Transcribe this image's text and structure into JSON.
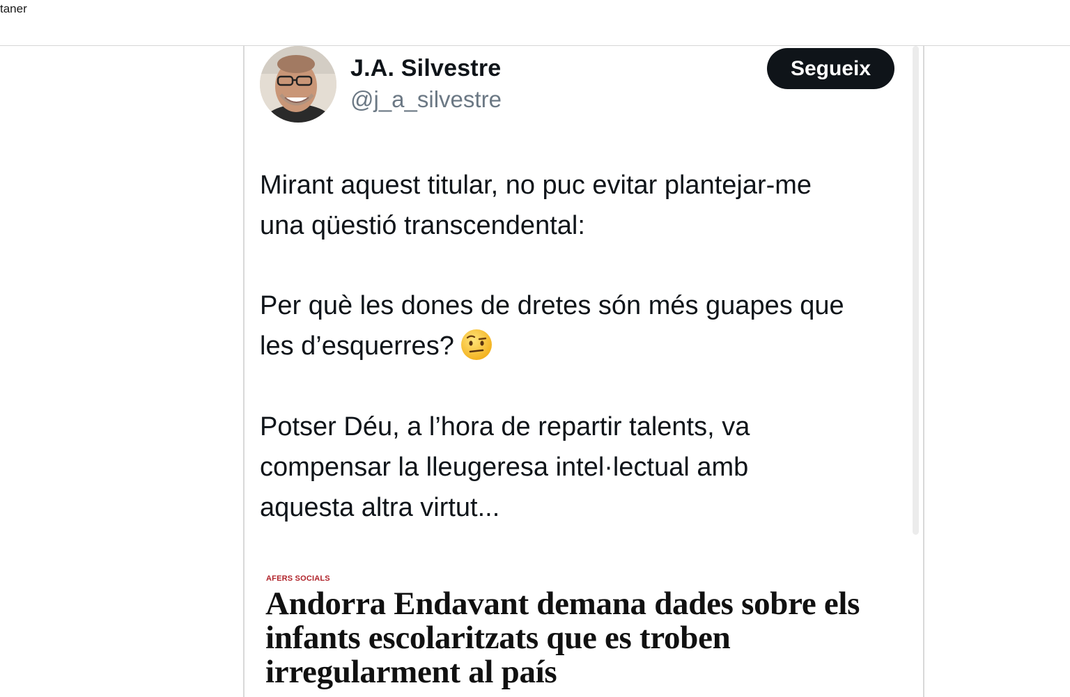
{
  "topbar": {
    "text": "taner"
  },
  "tweet": {
    "display_name": "J.A. Silvestre",
    "handle": "@j_a_silvestre",
    "follow_label": "Segueix",
    "paragraphs": [
      [
        "Mirant aquest titular, no puc evitar plantejar-me",
        "una qüestió transcendental:"
      ],
      [
        "Per què les dones de dretes són més guapes que",
        "les d’esquerres?"
      ],
      [
        "Potser Déu, a l’hora de repartir talents, va",
        "compensar la lleugeresa intel·lectual amb",
        "aquesta altra virtut..."
      ]
    ],
    "emoji": "face-with-raised-eyebrow-icon"
  },
  "article": {
    "section": "AFERS SOCIALS",
    "headline_lines": [
      "Andorra Endavant demana dades sobre els",
      "infants escolaritzats que es troben",
      "irregularment al país"
    ]
  },
  "colors": {
    "text": "#0f1419",
    "muted": "#6b7884",
    "button_bg": "#0f1419",
    "section_red": "#b0232a"
  }
}
